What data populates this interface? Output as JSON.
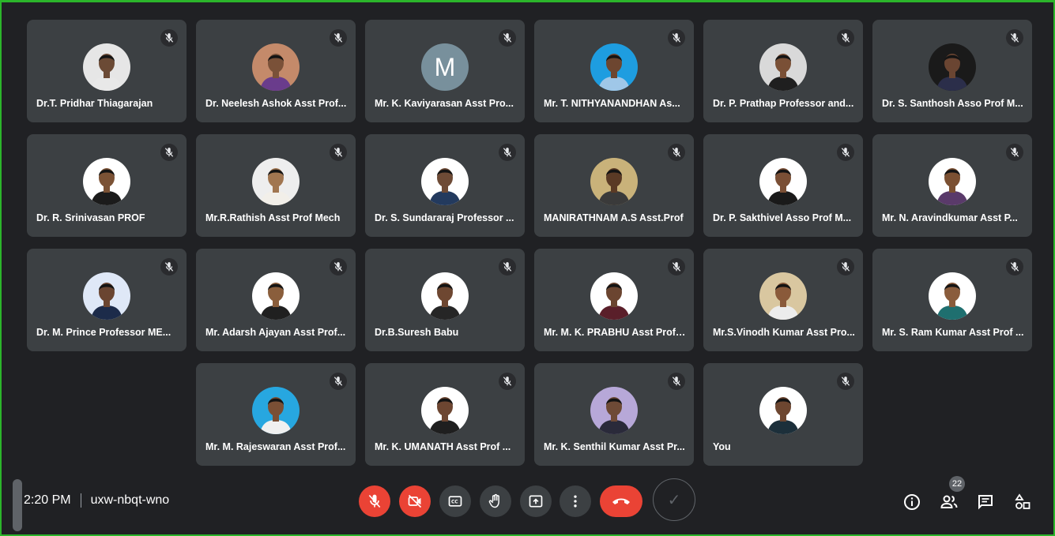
{
  "participants": [
    {
      "name": "Dr.T. Pridhar Thiagarajan",
      "avatar": "photo",
      "bg": "#e6e6e6",
      "skin": "#6b4a35",
      "shirt": "#e8e8e8"
    },
    {
      "name": "Dr. Neelesh Ashok Asst Prof...",
      "avatar": "photo",
      "bg": "#c48a6a",
      "skin": "#7a5138",
      "shirt": "#6a3c8c"
    },
    {
      "name": "Mr. K. Kaviyarasan Asst Pro...",
      "avatar": "letter",
      "letter": "M",
      "bg": "#78909c"
    },
    {
      "name": "Mr. T. NITHYANANDHAN As...",
      "avatar": "photo",
      "bg": "#1e9de0",
      "skin": "#6d4630",
      "shirt": "#9fc7e8"
    },
    {
      "name": "Dr. P. Prathap Professor and...",
      "avatar": "photo",
      "bg": "#d9d9d9",
      "skin": "#7a5036",
      "shirt": "#1f1f1f"
    },
    {
      "name": "Dr. S. Santhosh Asso Prof M...",
      "avatar": "photo",
      "bg": "#1a1a1a",
      "skin": "#6a4532",
      "shirt": "#2b2e4a"
    },
    {
      "name": "Dr. R. Srinivasan PROF",
      "avatar": "photo",
      "bg": "#ffffff",
      "skin": "#7b5235",
      "shirt": "#1b1b1b"
    },
    {
      "name": "Mr.R.Rathish Asst Prof Mech",
      "avatar": "photo",
      "bg": "#eeeeee",
      "skin": "#a17650",
      "shirt": "#f2efe9"
    },
    {
      "name": "Dr. S. Sundararaj Professor ...",
      "avatar": "photo",
      "bg": "#ffffff",
      "skin": "#6e4b36",
      "shirt": "#233a5e"
    },
    {
      "name": "MANIRATHNAM A.S Asst.Prof",
      "avatar": "photo",
      "bg": "#c9b27a",
      "skin": "#5a3a25",
      "shirt": "#3a3a3a"
    },
    {
      "name": "Dr. P. Sakthivel Asso Prof M...",
      "avatar": "photo",
      "bg": "#ffffff",
      "skin": "#7a4f35",
      "shirt": "#1a1a1a"
    },
    {
      "name": "Mr. N. Aravindkumar Asst P...",
      "avatar": "photo",
      "bg": "#ffffff",
      "skin": "#7b5032",
      "shirt": "#5a3a6a"
    },
    {
      "name": "Dr. M. Prince Professor ME...",
      "avatar": "photo",
      "bg": "#dfe8f7",
      "skin": "#6a4531",
      "shirt": "#1c2b4a"
    },
    {
      "name": "Mr. Adarsh Ajayan Asst Prof...",
      "avatar": "photo",
      "bg": "#ffffff",
      "skin": "#8a5e3c",
      "shirt": "#202020"
    },
    {
      "name": "Dr.B.Suresh Babu",
      "avatar": "photo",
      "bg": "#ffffff",
      "skin": "#6e4731",
      "shirt": "#262626"
    },
    {
      "name": "Mr. M. K. PRABHU Asst Prof ...",
      "avatar": "photo",
      "bg": "#ffffff",
      "skin": "#6b4530",
      "shirt": "#5a1f2a"
    },
    {
      "name": "Mr.S.Vinodh Kumar Asst Pro...",
      "avatar": "photo",
      "bg": "#d9c7a0",
      "skin": "#8a5a3a",
      "shirt": "#ececec"
    },
    {
      "name": "Mr. S. Ram Kumar Asst Prof ...",
      "avatar": "photo",
      "bg": "#ffffff",
      "skin": "#8a5c3c",
      "shirt": "#1f6f6f"
    },
    {
      "name": "Mr. M. Rajeswaran Asst Prof...",
      "avatar": "photo",
      "bg": "#27a7e0",
      "skin": "#7a4f35",
      "shirt": "#f0f0f0"
    },
    {
      "name": "Mr. K. UMANATH Asst Prof ...",
      "avatar": "photo",
      "bg": "#ffffff",
      "skin": "#6d4631",
      "shirt": "#1f1f1f"
    },
    {
      "name": "Mr. K. Senthil Kumar Asst Pr...",
      "avatar": "photo",
      "bg": "#b7a8d8",
      "skin": "#6e4a36",
      "shirt": "#2a2a3a"
    },
    {
      "name": "You",
      "avatar": "photo",
      "bg": "#ffffff",
      "skin": "#6d4630",
      "shirt": "#1c2f3a"
    }
  ],
  "meeting": {
    "time": "2:20 PM",
    "code": "uxw-nbqt-wno"
  },
  "people_count": "22",
  "icons": {
    "mic_off": "mic-off-icon",
    "camera_off": "camera-off-icon",
    "captions": "captions-icon",
    "raise_hand": "raise-hand-icon",
    "present": "present-screen-icon",
    "more": "more-options-icon",
    "end_call": "end-call-icon",
    "info": "info-icon",
    "people": "people-icon",
    "chat": "chat-icon",
    "activities": "activities-icon"
  },
  "colors": {
    "end_call": "#ea4335",
    "frame": "#2bb52b",
    "tile": "#3c4043"
  }
}
